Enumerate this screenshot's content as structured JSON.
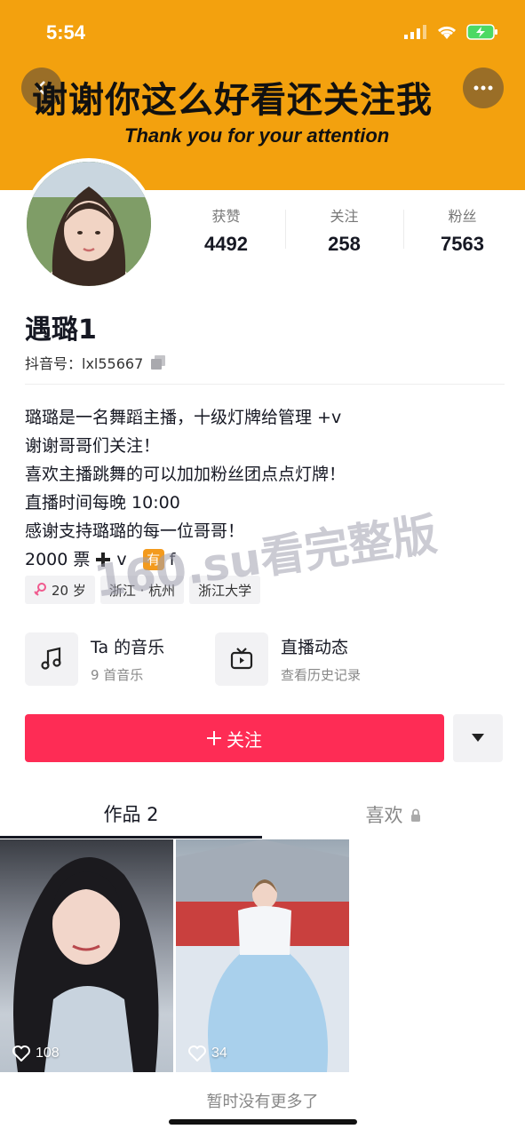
{
  "status_bar": {
    "time": "5:54"
  },
  "banner": {
    "title": "谢谢你这么好看还关注我",
    "subtitle": "Thank you for your attention"
  },
  "stats": [
    {
      "label": "获赞",
      "value": "4492"
    },
    {
      "label": "关注",
      "value": "258"
    },
    {
      "label": "粉丝",
      "value": "7563"
    }
  ],
  "profile": {
    "name": "遇璐1",
    "douyin_id": "抖音号：lxl55667"
  },
  "bio": {
    "lines": [
      "璐璐是一名舞蹈主播，十级灯牌给管理 +v",
      "谢谢哥哥们关注！",
      "喜欢主播跳舞的可以加加粉丝团点点灯牌！",
      "直播时间每晚 10:00",
      "感谢支持璐璐的每一位哥哥！"
    ],
    "ticket_text": "2000 票",
    "plus_v": "v",
    "you_badge": "有",
    "f_text": "f"
  },
  "tags": {
    "age": "20 岁",
    "location": "浙江 · 杭州",
    "school": "浙江大学"
  },
  "entries": {
    "music_title": "Ta 的音乐",
    "music_sub": "9 首音乐",
    "live_title": "直播动态",
    "live_sub": "查看历史记录"
  },
  "actions": {
    "follow_label": "关注"
  },
  "tabs": {
    "works": "作品 2",
    "likes": "喜欢"
  },
  "videos": [
    {
      "likes": "108"
    },
    {
      "likes": "34"
    }
  ],
  "footer": {
    "no_more": "暂时没有更多了"
  },
  "watermark": "160.su看完整版",
  "colors": {
    "banner": "#f3a10e",
    "follow": "#fe2c55"
  }
}
